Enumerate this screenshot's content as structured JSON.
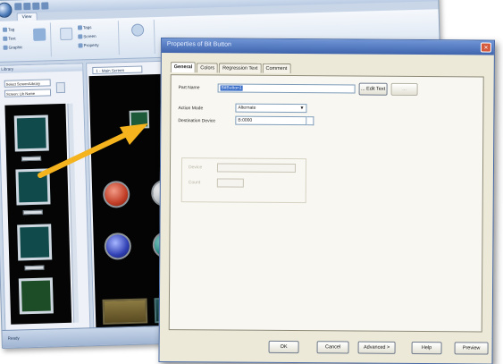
{
  "app": {
    "tabs": [
      "View",
      "",
      "",
      ""
    ],
    "ribbon_buttons": [
      {
        "label": "Tag",
        "icon": "tag-icon"
      },
      {
        "label": "Text",
        "icon": "text-icon"
      },
      {
        "label": "Graphic",
        "icon": "graphic-icon"
      },
      {
        "label": "Tags",
        "icon": "tags-icon"
      },
      {
        "label": "Screen",
        "icon": "screen-icon"
      },
      {
        "label": "Property",
        "icon": "property-icon"
      }
    ],
    "left_panel_title": "Library",
    "left_combo_1": "Select Screen/Library",
    "left_combo_2": "Screen: Lib Name",
    "canvas_tab": "1 - Main Screen",
    "status_text": "Ready"
  },
  "dialog": {
    "title": "Properties of Bit Button",
    "close_glyph": "×",
    "tabs": [
      {
        "label": "General",
        "selected": true
      },
      {
        "label": "Colors",
        "selected": false
      },
      {
        "label": "Regression Text",
        "selected": false
      },
      {
        "label": "Comment",
        "selected": false
      }
    ],
    "fields": {
      "part_name_label": "Part Name",
      "part_name_value": "BitButton1",
      "edit_text_button": "... Edit Text",
      "third_button": "...",
      "action_mode_label": "Action Mode",
      "action_mode_value": "Alternate",
      "destination_device_label": "Destination Device",
      "destination_device_value": "B:0000"
    },
    "faded_group": {
      "label_1": "Device",
      "label_2": "Count"
    },
    "buttons": {
      "ok": "OK",
      "cancel": "Cancel",
      "advanced": "Advanced >",
      "help": "Help",
      "preview": "Preview"
    }
  },
  "colors": {
    "arrow": "#f5b41e",
    "dialog_title": "#3f64ad",
    "canvas": "#040404"
  }
}
